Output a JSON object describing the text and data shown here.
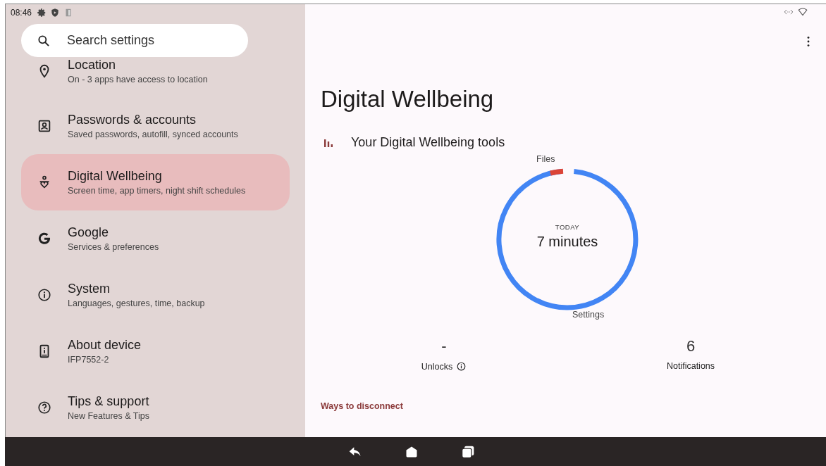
{
  "status_bar": {
    "time": "08:46"
  },
  "search": {
    "placeholder": "Search settings"
  },
  "settings_items": [
    {
      "kind": "location",
      "title": "Location",
      "subtitle": "On - 3 apps have access to location",
      "selected": false
    },
    {
      "kind": "account",
      "title": "Passwords & accounts",
      "subtitle": "Saved passwords, autofill, synced accounts",
      "selected": false
    },
    {
      "kind": "wellbeing",
      "title": "Digital Wellbeing",
      "subtitle": "Screen time, app timers, night shift schedules",
      "selected": true
    },
    {
      "kind": "google",
      "title": "Google",
      "subtitle": "Services & preferences",
      "selected": false
    },
    {
      "kind": "system",
      "title": "System",
      "subtitle": "Languages, gestures, time, backup",
      "selected": false
    },
    {
      "kind": "device",
      "title": "About device",
      "subtitle": "IFP7552-2",
      "selected": false
    },
    {
      "kind": "help",
      "title": "Tips & support",
      "subtitle": "New Features & Tips",
      "selected": false
    }
  ],
  "page": {
    "title": "Digital Wellbeing",
    "section_title": "Your Digital Wellbeing tools",
    "donut": {
      "center_label": "TODAY",
      "center_value": "7 minutes",
      "segment_labels": [
        "Files",
        "Settings"
      ]
    },
    "stats": [
      {
        "value": "-",
        "label": "Unlocks",
        "info": true
      },
      {
        "value": "6",
        "label": "Notifications",
        "info": false
      }
    ],
    "link": "Ways to disconnect"
  }
}
